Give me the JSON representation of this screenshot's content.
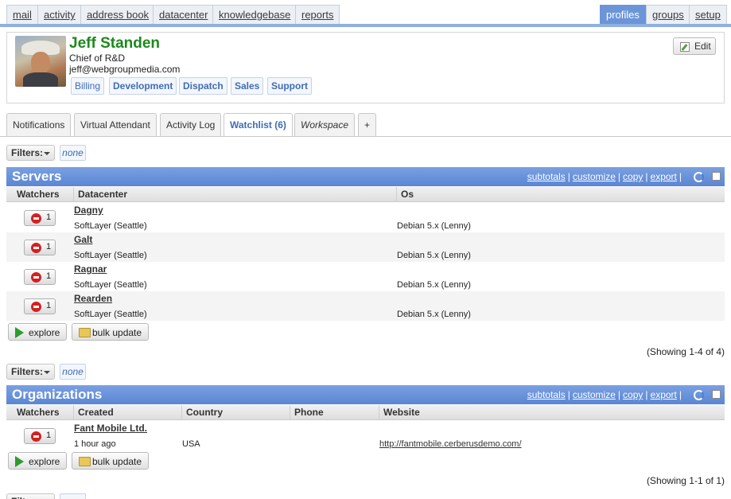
{
  "topnav": {
    "left": [
      "mail",
      "activity",
      "address book",
      "datacenter",
      "knowledgebase",
      "reports"
    ],
    "right": [
      "profiles",
      "groups",
      "setup"
    ],
    "active": "profiles"
  },
  "profile": {
    "name": "Jeff Standen",
    "title": "Chief of R&D",
    "email": "jeff@webgroupmedia.com",
    "groups": [
      "Billing",
      "Development",
      "Dispatch",
      "Sales",
      "Support"
    ],
    "edit_label": "Edit"
  },
  "subtabs": [
    "Notifications",
    "Virtual Attendant",
    "Activity Log",
    "Watchlist (6)",
    "Workspace",
    "+"
  ],
  "filters": {
    "label": "Filters:",
    "value": "none"
  },
  "servers": {
    "title": "Servers",
    "links": [
      "subtotals",
      "customize",
      "copy",
      "export"
    ],
    "columns": [
      "Watchers",
      "Datacenter",
      "Os"
    ],
    "rows": [
      {
        "name": "Dagny",
        "watchers": "1",
        "datacenter": "SoftLayer (Seattle)",
        "os": "Debian 5.x (Lenny)"
      },
      {
        "name": "Galt",
        "watchers": "1",
        "datacenter": "SoftLayer (Seattle)",
        "os": "Debian 5.x (Lenny)"
      },
      {
        "name": "Ragnar",
        "watchers": "1",
        "datacenter": "SoftLayer (Seattle)",
        "os": "Debian 5.x (Lenny)"
      },
      {
        "name": "Rearden",
        "watchers": "1",
        "datacenter": "SoftLayer (Seattle)",
        "os": "Debian 5.x (Lenny)"
      }
    ],
    "explore_label": "explore",
    "bulk_label": "bulk update",
    "showing": "(Showing 1-4 of 4)"
  },
  "organizations": {
    "title": "Organizations",
    "links": [
      "subtotals",
      "customize",
      "copy",
      "export"
    ],
    "columns": [
      "Watchers",
      "Created",
      "Country",
      "Phone",
      "Website"
    ],
    "rows": [
      {
        "name": "Fant Mobile Ltd.",
        "watchers": "1",
        "created": "1 hour ago",
        "country": "USA",
        "phone": "",
        "website": "http://fantmobile.cerberusdemo.com/"
      }
    ],
    "explore_label": "explore",
    "bulk_label": "bulk update",
    "showing": "(Showing 1-1 of 1)"
  }
}
